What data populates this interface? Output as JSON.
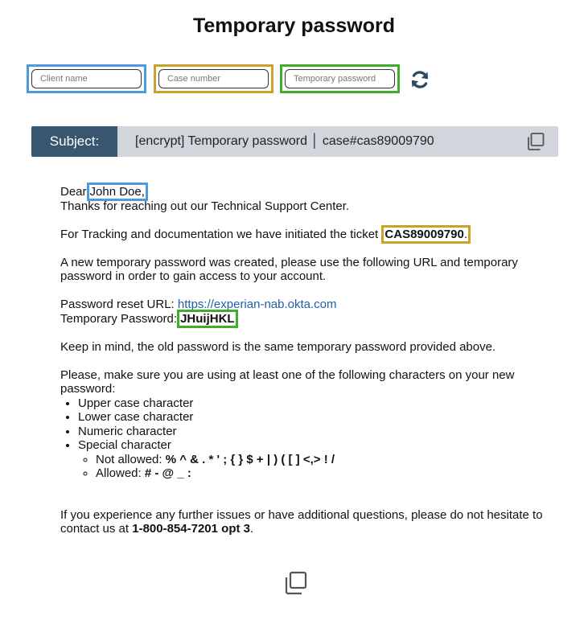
{
  "page": {
    "title": "Temporary password"
  },
  "fields": {
    "client_name_placeholder": "Client name",
    "case_number_placeholder": "Case number",
    "temp_password_placeholder": "Temporary password"
  },
  "icons": {
    "refresh": "refresh-icon",
    "copy": "copy-icon"
  },
  "colors": {
    "blue": "#4a9be0",
    "gold": "#c9a227",
    "green": "#3fae2a",
    "subject_label_bg": "#385670",
    "subject_bar_bg": "#d2d6dc",
    "link": "#1f5fa8"
  },
  "subject": {
    "label": "Subject:",
    "text": "[encrypt] Temporary password │ case#cas89009790"
  },
  "email": {
    "greeting_prefix": "Dear",
    "client_name": "John Doe,",
    "thanks": "Thanks for reaching out our Technical Support Center.",
    "ticket_prefix": "For Tracking and documentation we have initiated the ticket",
    "ticket_number": "CAS89009790",
    "ticket_suffix": ".",
    "new_password_intro": "A new temporary password was created, please use the following URL and temporary password in order to gain access to your account.",
    "reset_url_label": "Password reset URL:",
    "reset_url": "https://experian-nab.okta.com",
    "temp_password_label": "Temporary Password:",
    "temp_password": "JHuijHKL",
    "old_password_note": "Keep in mind, the old password is the same temporary password provided above.",
    "requirements_intro": "Please, make sure you are using at least one of the following characters on your new password:",
    "requirements": [
      "Upper case character",
      "Lower case character",
      "Numeric character",
      "Special character"
    ],
    "not_allowed_label": "Not allowed:",
    "not_allowed_chars": "% ^ & . * ' ; { } $ + | ) ( [ ] <,> ! /",
    "allowed_label": "Allowed:",
    "allowed_chars": "# - @ _ :",
    "closing_prefix": "If you experience any further issues or have additional questions, please do not hesitate to contact us at",
    "phone": "1-800-854-7201 opt 3",
    "closing_suffix": "."
  }
}
